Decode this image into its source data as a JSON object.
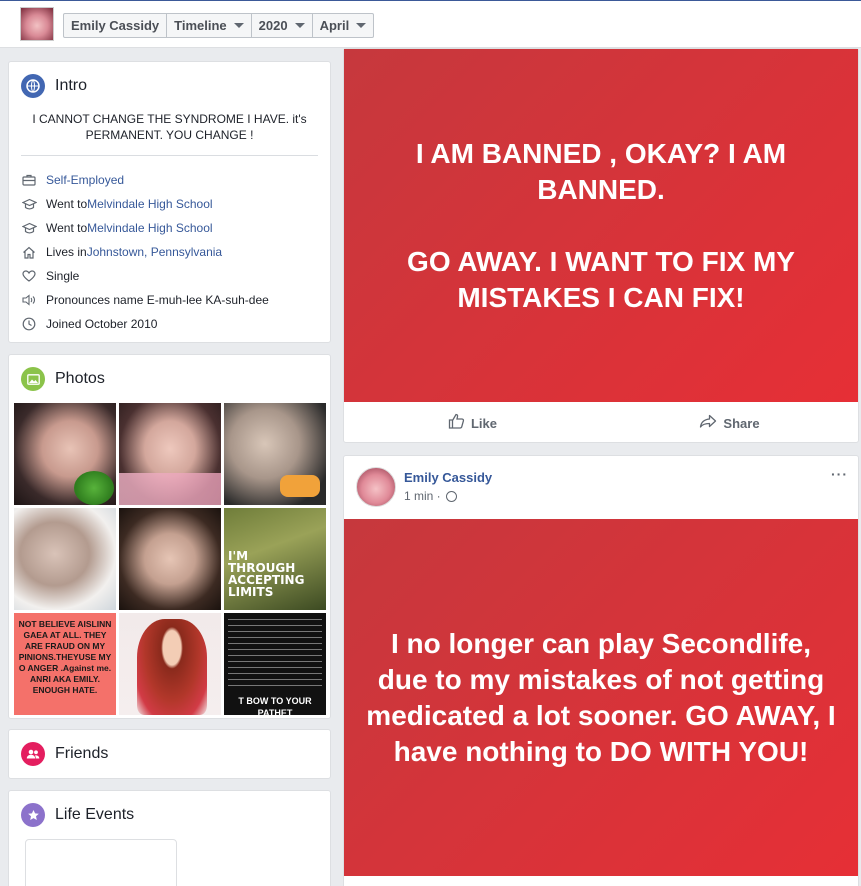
{
  "header": {
    "name": "Emily Cassidy",
    "section": "Timeline",
    "year": "2020",
    "month": "April"
  },
  "intro": {
    "title": "Intro",
    "bio": "I CANNOT CHANGE THE SYNDROME I HAVE. it's PERMANENT. YOU CHANGE !",
    "items": [
      {
        "icon": "briefcase-icon",
        "prefix": "",
        "link": "Self-Employed"
      },
      {
        "icon": "graduation-cap-icon",
        "prefix": "Went to ",
        "link": "Melvindale High School"
      },
      {
        "icon": "graduation-cap-icon",
        "prefix": "Went to ",
        "link": "Melvindale High School"
      },
      {
        "icon": "home-icon",
        "prefix": "Lives in ",
        "link": "Johnstown, Pennsylvania"
      },
      {
        "icon": "heart-icon",
        "prefix": "Single",
        "link": ""
      },
      {
        "icon": "speaker-icon",
        "prefix": "Pronounces name E-muh-lee KA-suh-dee",
        "link": ""
      },
      {
        "icon": "clock-icon",
        "prefix": "Joined October 2010",
        "link": ""
      }
    ]
  },
  "photos": {
    "title": "Photos",
    "captions": {
      "p6": "I'M THROUGH ACCEPTING LIMITS",
      "p7": "NOT BELIEVE AISLINN GAEA AT ALL. THEY ARE FRAUD ON MY PINIONS.THEYUSE MY O ANGER .Against me. ANRI AKA EMILY. ENOUGH HATE.",
      "p9": "T BOW TO YOUR PATHET"
    }
  },
  "friends": {
    "title": "Friends"
  },
  "life_events": {
    "title": "Life Events"
  },
  "post1": {
    "line1": "I AM BANNED , OKAY? I AM BANNED.",
    "line2": "GO AWAY. I WANT TO FIX MY MISTAKES I CAN FIX!",
    "like": "Like",
    "share": "Share"
  },
  "post2": {
    "author": "Emily Cassidy",
    "time": "1 min ·",
    "text": "I no longer can play Secondlife, due to my mistakes of not getting medicated a lot sooner. GO AWAY, I have nothing to DO WITH YOU!"
  },
  "colors": {
    "brand": "#365899",
    "post_bg": "#e2343a",
    "intro_icon": "#4267b2",
    "photos_icon": "#8bc34a",
    "friends_icon": "#e41e5f",
    "life_icon": "#8c72cb"
  }
}
